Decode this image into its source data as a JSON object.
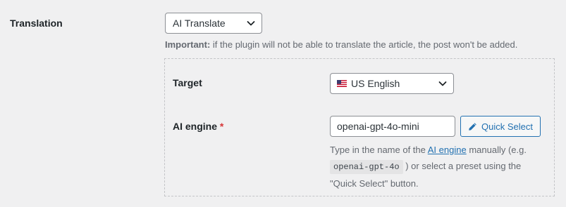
{
  "translation": {
    "label": "Translation",
    "select_value": "AI Translate",
    "note_bold": "Important:",
    "note_text": " if the plugin will not be able to translate the article, the post won't be added."
  },
  "target": {
    "label": "Target",
    "flag_icon": "us-flag-icon",
    "select_value": "US English"
  },
  "ai_engine": {
    "label": "AI engine",
    "required_marker": "*",
    "input_value": "openai-gpt-4o-mini",
    "quick_select_label": "Quick Select",
    "quick_select_icon": "pencil-icon",
    "help_part1": "Type in the name of the ",
    "help_link": "AI engine",
    "help_part2": " manually (e.g. ",
    "help_code": "openai-gpt-4o",
    "help_part3": " ) or select a preset using the \"Quick Select\" button."
  },
  "colors": {
    "accent": "#2271b1",
    "required": "#d63638",
    "background": "#f0f0f1",
    "muted_text": "#646970"
  }
}
